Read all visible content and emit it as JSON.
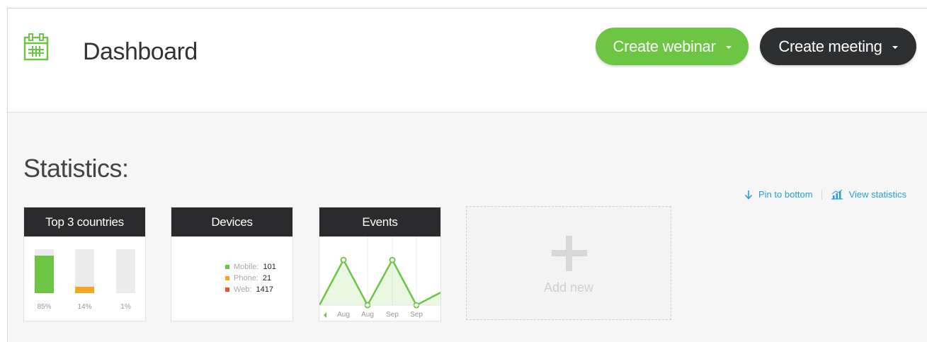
{
  "header": {
    "icon": "calendar-icon",
    "title": "Dashboard",
    "create_webinar_label": "Create webinar",
    "create_meeting_label": "Create meeting"
  },
  "colors": {
    "accent_green": "#6cc644",
    "dark": "#2b2b2d",
    "orange": "#f5a623",
    "red": "#e8542f",
    "link_blue": "#2a9fd6"
  },
  "statistics": {
    "title": "Statistics:",
    "actions": {
      "pin_to_bottom": "Pin to bottom",
      "pin_icon": "arrow-down-icon",
      "view_statistics": "View statistics",
      "view_icon": "bar-chart-icon"
    }
  },
  "cards": {
    "countries": {
      "title": "Top 3 countries",
      "bars": [
        {
          "label": "85%",
          "value": 0.85,
          "color": "#6cc644"
        },
        {
          "label": "14%",
          "value": 0.14,
          "color": "#f5a623"
        },
        {
          "label": "1%",
          "value": 0.01,
          "color": "#ececec"
        }
      ]
    },
    "devices": {
      "title": "Devices",
      "items": [
        {
          "name": "Mobile:",
          "value": "101",
          "color": "#6cc644"
        },
        {
          "name": "Phone:",
          "value": "21",
          "color": "#f5a623"
        },
        {
          "name": "Web:",
          "value": "1417",
          "color": "#e8542f"
        }
      ]
    },
    "events": {
      "title": "Events",
      "labels": [
        "Aug",
        "Aug",
        "Sep",
        "Sep"
      ],
      "values": [
        0.0,
        0.9,
        0.0,
        0.9,
        0.0,
        0.25
      ],
      "prev_icon": "triangle-left-icon"
    }
  },
  "add_new": {
    "icon": "plus-icon",
    "label": "Add new"
  },
  "chart_data": {
    "type": "line",
    "title": "Events",
    "x": [
      "Aug",
      "Aug",
      "Sep",
      "Sep"
    ],
    "series": [
      {
        "values": [
          0.0,
          0.9,
          0.0,
          0.9,
          0.0,
          0.25
        ]
      }
    ]
  }
}
